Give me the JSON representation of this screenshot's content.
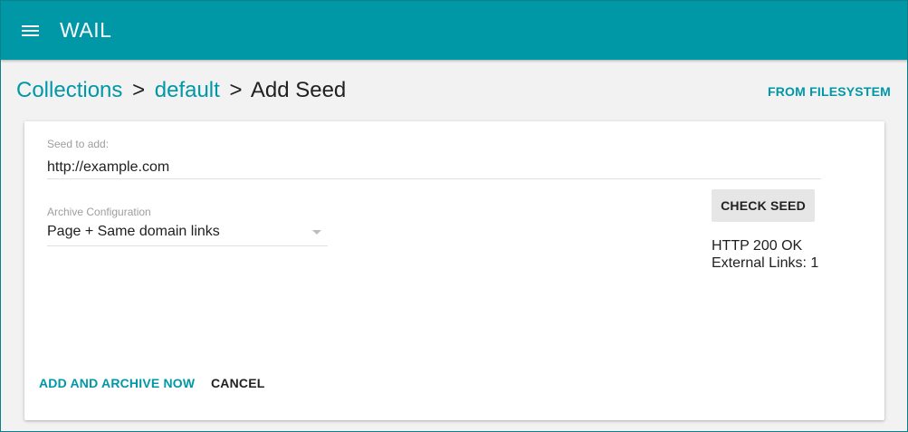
{
  "app": {
    "title": "WAIL"
  },
  "header": {
    "menu_icon": "hamburger-menu-icon"
  },
  "breadcrumb": {
    "items": [
      "Collections",
      "default",
      "Add Seed"
    ],
    "separator": ">"
  },
  "actions": {
    "from_filesystem": "FROM FILESYSTEM"
  },
  "form": {
    "seed": {
      "label": "Seed to add:",
      "value": "http://example.com"
    },
    "archive_config": {
      "label": "Archive Configuration",
      "selected": "Page + Same domain links",
      "arrow_icon": "dropdown-arrow-icon"
    },
    "check_seed_label": "CHECK SEED",
    "status": {
      "http": "HTTP 200 OK",
      "external_links": "External Links: 1"
    },
    "add_archive_label": "ADD AND ARCHIVE NOW",
    "cancel_label": "CANCEL"
  },
  "colors": {
    "accent": "#0097a7",
    "background": "#f2f2f2",
    "card": "#ffffff"
  }
}
